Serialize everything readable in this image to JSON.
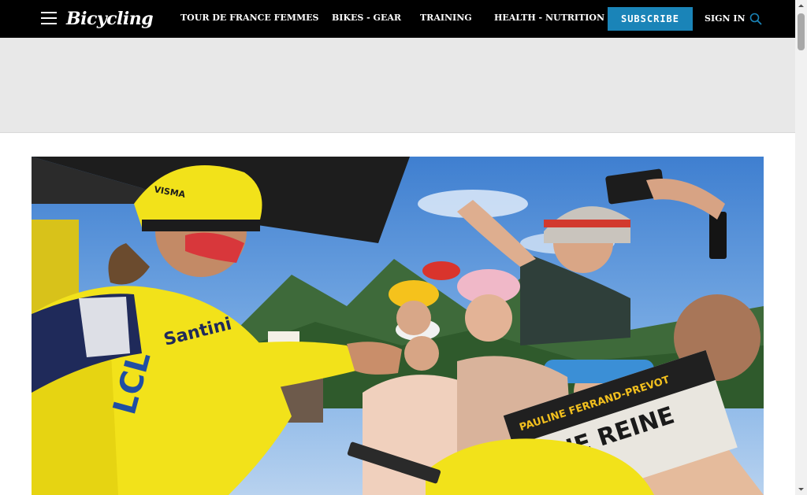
{
  "nav": {
    "logo": "Bicycling",
    "menu_icon": "hamburger-icon",
    "links": [
      {
        "label": "TOUR DE FRANCE FEMMES"
      },
      {
        "label": "BIKES - GEAR"
      },
      {
        "label": "TRAINING"
      },
      {
        "label": "HEALTH - NUTRITION"
      }
    ],
    "subscribe_label": "SUBSCRIBE",
    "signin_label": "SIGN IN",
    "search_icon": "search-icon"
  },
  "hero": {
    "newspaper_headline": "UNE REINE",
    "newspaper_subline": "PAULINE FERRAND-PREVOT",
    "jersey_text": "Santini",
    "jersey_sponsor": "LCL",
    "helmet_text": "VISMA"
  },
  "colors": {
    "nav_bg": "#000000",
    "subscribe_bg": "#1a84b8",
    "ad_bg": "#e8e8e8",
    "jersey_yellow": "#f2e21a"
  }
}
